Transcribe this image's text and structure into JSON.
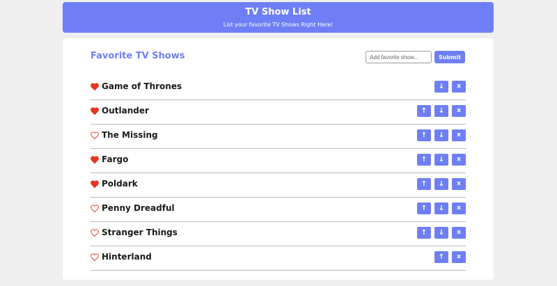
{
  "header": {
    "title": "TV Show List",
    "subtitle": "List your favorite TV Shows Right Here!"
  },
  "main": {
    "title": "Favorite TV Shows",
    "form": {
      "placeholder": "Add favorite show...",
      "value": "",
      "submit_label": "Submit"
    },
    "shows": [
      {
        "name": "Game of Thrones",
        "favorite": true,
        "can_move_up": false,
        "can_move_down": true
      },
      {
        "name": "Outlander",
        "favorite": true,
        "can_move_up": true,
        "can_move_down": true
      },
      {
        "name": "The Missing",
        "favorite": false,
        "can_move_up": true,
        "can_move_down": true
      },
      {
        "name": "Fargo",
        "favorite": true,
        "can_move_up": true,
        "can_move_down": true
      },
      {
        "name": "Poldark",
        "favorite": true,
        "can_move_up": true,
        "can_move_down": true
      },
      {
        "name": "Penny Dreadful",
        "favorite": false,
        "can_move_up": true,
        "can_move_down": true
      },
      {
        "name": "Stranger Things",
        "favorite": false,
        "can_move_up": true,
        "can_move_down": true
      },
      {
        "name": "Hinterland",
        "favorite": false,
        "can_move_up": true,
        "can_move_down": false
      }
    ],
    "action_labels": {
      "up": "↑",
      "down": "↓",
      "remove": "x"
    },
    "icons": {
      "favorite": "heart-filled-icon",
      "not_favorite": "heart-outline-icon"
    }
  },
  "colors": {
    "accent": "#6e7ff5",
    "heart": "#e8341c",
    "background": "#efefef",
    "card": "#ffffff"
  }
}
